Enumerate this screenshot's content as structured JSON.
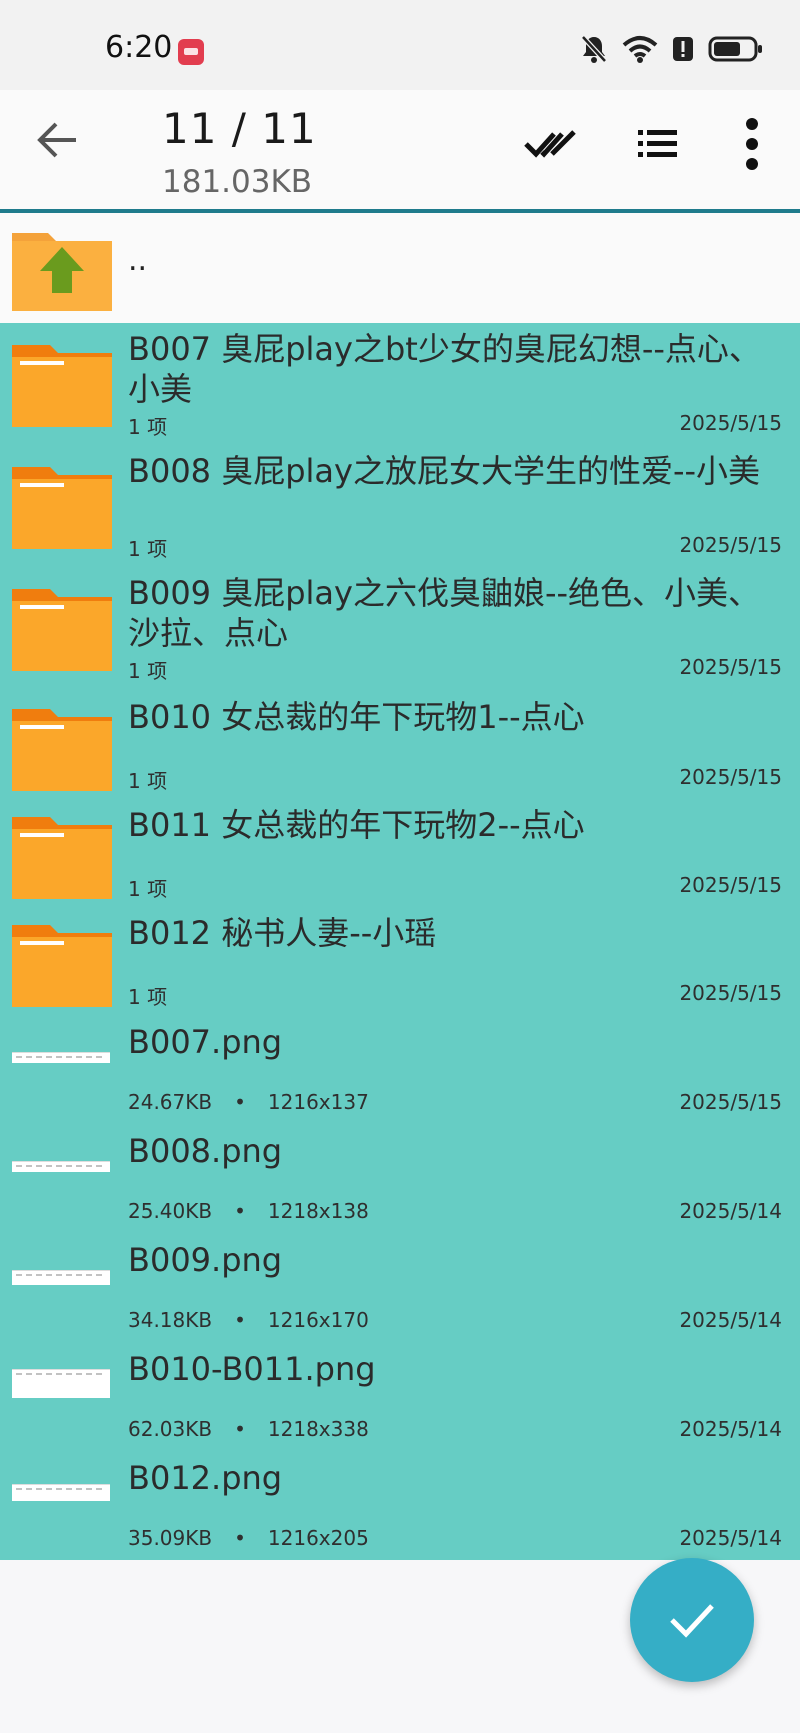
{
  "status_bar": {
    "time": "6:20",
    "icons": [
      "app-badge-icon",
      "bell-muted-icon",
      "wifi-icon",
      "alert-icon",
      "battery-icon"
    ]
  },
  "header": {
    "title": "11 / 11",
    "subtitle": "181.03KB",
    "actions": [
      "back-icon",
      "select-all-icon",
      "list-view-icon",
      "more-icon"
    ]
  },
  "parent": {
    "label": ".."
  },
  "colors": {
    "selection": "#66cdc4",
    "accent": "#1f7b8c",
    "fab": "#35aec6",
    "folder": "#fba72a"
  },
  "items": [
    {
      "type": "folder",
      "name": "B007 臭屁play之bt少女的臭屁幻想--点心、小美",
      "meta": "1 项",
      "date": "2025/5/15"
    },
    {
      "type": "folder",
      "name": "B008 臭屁play之放屁女大学生的性爱--小美",
      "meta": "1 项",
      "date": "2025/5/15"
    },
    {
      "type": "folder",
      "name": "B009 臭屁play之六伐臭鼬娘--绝色、小美、沙拉、点心",
      "meta": "1 项",
      "date": "2025/5/15"
    },
    {
      "type": "folder",
      "name": "B010 女总裁的年下玩物1--点心",
      "meta": "1 项",
      "date": "2025/5/15"
    },
    {
      "type": "folder",
      "name": "B011 女总裁的年下玩物2--点心",
      "meta": "1 项",
      "date": "2025/5/15"
    },
    {
      "type": "folder",
      "name": "B012 秘书人妻--小瑶",
      "meta": "1 项",
      "date": "2025/5/15"
    },
    {
      "type": "image",
      "name": "B007.png",
      "size": "24.67KB",
      "dims": "1216x137",
      "date": "2025/5/15"
    },
    {
      "type": "image",
      "name": "B008.png",
      "size": "25.40KB",
      "dims": "1218x138",
      "date": "2025/5/14"
    },
    {
      "type": "image",
      "name": "B009.png",
      "size": "34.18KB",
      "dims": "1216x170",
      "date": "2025/5/14"
    },
    {
      "type": "image",
      "name": "B010-B011.png",
      "size": "62.03KB",
      "dims": "1218x338",
      "date": "2025/5/14"
    },
    {
      "type": "image",
      "name": "B012.png",
      "size": "35.09KB",
      "dims": "1216x205",
      "date": "2025/5/14"
    }
  ],
  "fab": {
    "icon": "check-icon"
  }
}
